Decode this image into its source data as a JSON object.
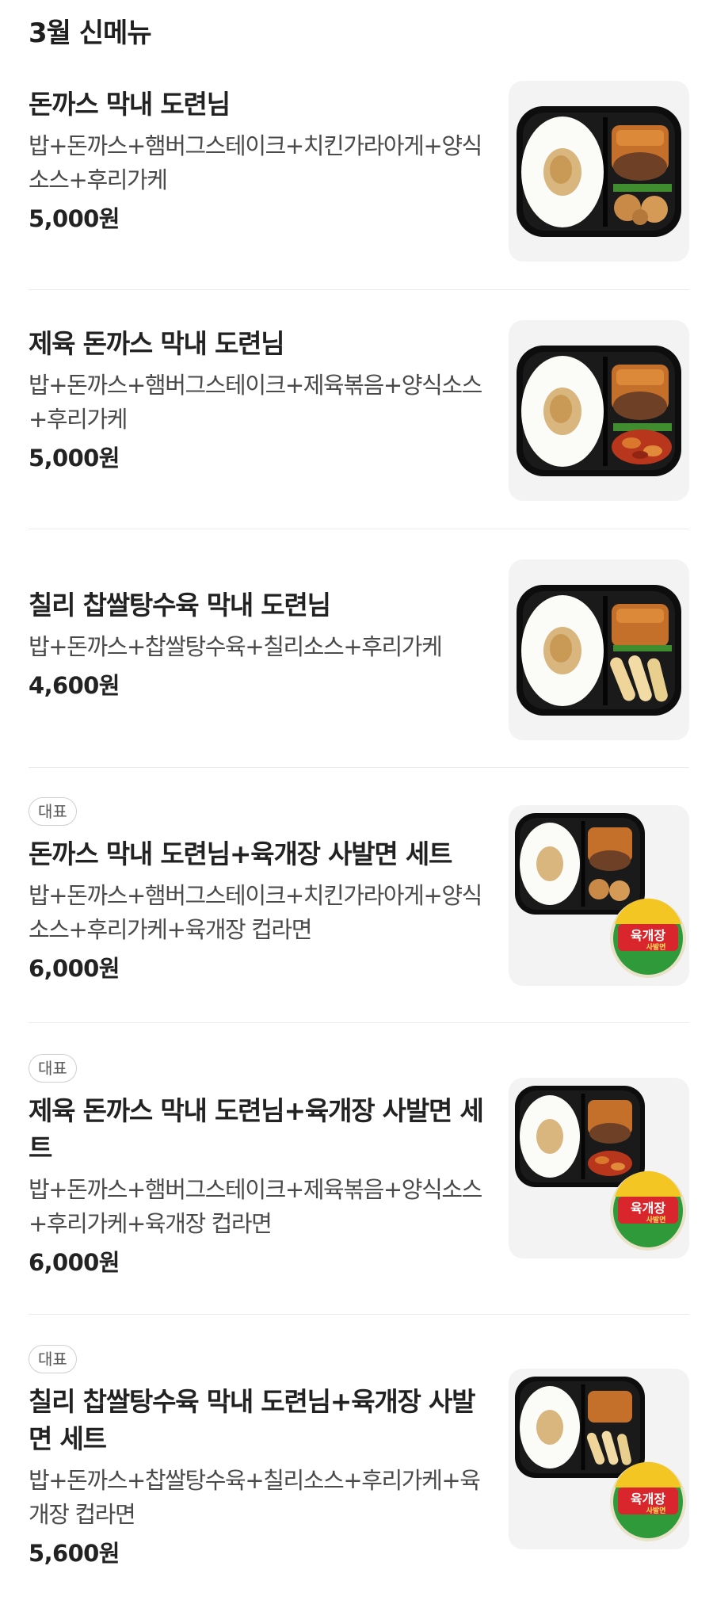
{
  "section_title": "3월 신메뉴",
  "items": [
    {
      "badge": "",
      "name": "돈까스 막내 도련님",
      "description": "밥+돈까스+햄버그스테이크+치킨가라아게+양식소스+후리가케",
      "price": "5,000원",
      "image": "lunchbox-chicken"
    },
    {
      "badge": "",
      "name": "제육 돈까스 막내 도련님",
      "description": "밥+돈까스+햄버그스테이크+제육볶음+양식소스+후리가케",
      "price": "5,000원",
      "image": "lunchbox-pork"
    },
    {
      "badge": "",
      "name": "칠리 찹쌀탕수육 막내 도련님",
      "description": "밥+돈까스+찹쌀탕수육+칠리소스+후리가케",
      "price": "4,600원",
      "image": "lunchbox-tangsuyuk"
    },
    {
      "badge": "대표",
      "name": "돈까스 막내 도련님+육개장 사발면 세트",
      "description": "밥+돈까스+햄버그스테이크+치킨가라아게+양식소스+후리가케+육개장 컵라면",
      "price": "6,000원",
      "image": "lunchbox-chicken-with-cup-noodle"
    },
    {
      "badge": "대표",
      "name": "제육 돈까스 막내 도련님+육개장 사발면 세트",
      "description": "밥+돈까스+햄버그스테이크+제육볶음+양식소스+후리가케+육개장 컵라면",
      "price": "6,000원",
      "image": "lunchbox-pork-with-cup-noodle"
    },
    {
      "badge": "대표",
      "name": "칠리 찹쌀탕수육 막내 도련님+육개장 사발면 세트",
      "description": "밥+돈까스+찹쌀탕수육+칠리소스+후리가케+육개장 컵라면",
      "price": "5,600원",
      "image": "lunchbox-tangsuyuk-with-cup-noodle"
    }
  ],
  "noodle_label": {
    "main": "육개장",
    "sub": "사발면"
  },
  "colors": {
    "text": "#222222",
    "description": "#4a4a4a",
    "thumb_bg": "#f3f3f3",
    "divider": "#ebebeb",
    "noodle_red": "#d8262c",
    "noodle_yellow": "#f3c623"
  }
}
